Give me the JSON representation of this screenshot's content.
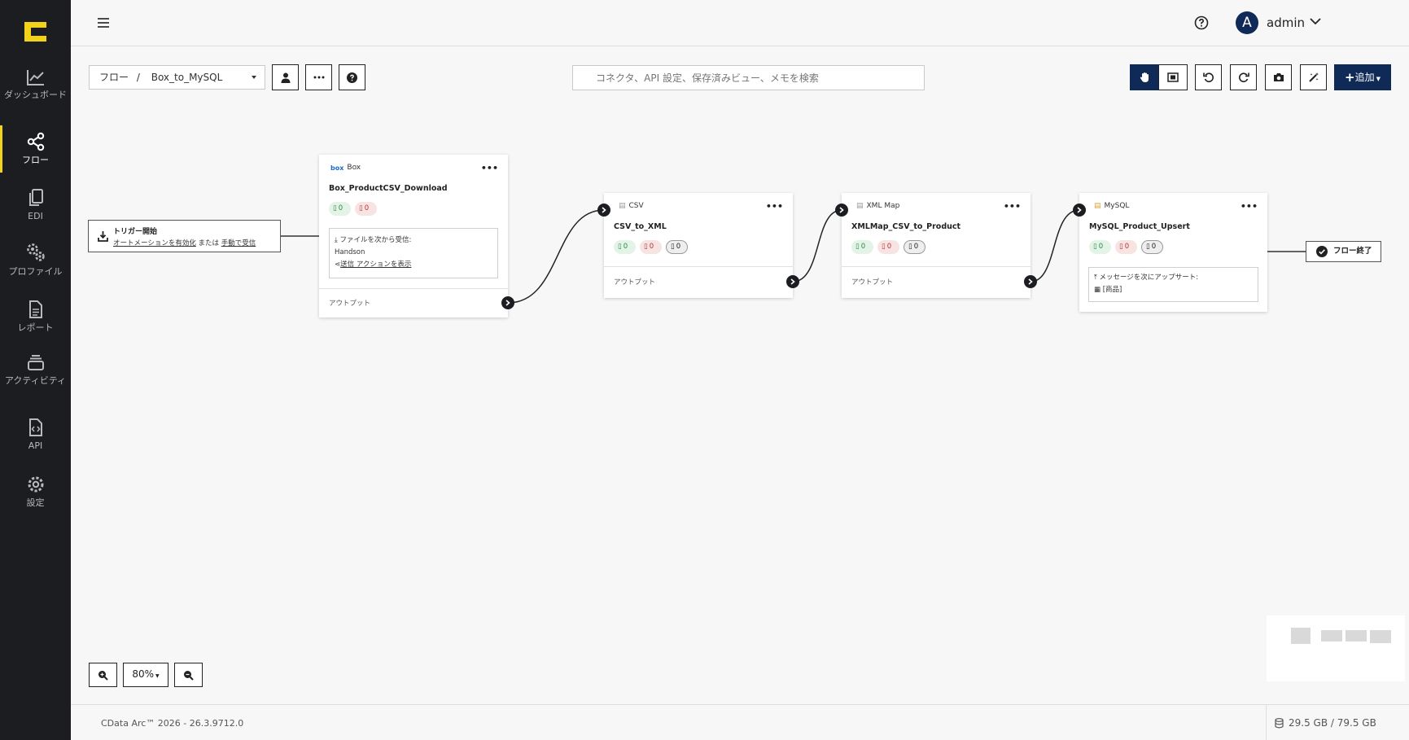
{
  "sidebar": {
    "items": [
      {
        "label": "ダッシュボード"
      },
      {
        "label": "フロー"
      },
      {
        "label": "EDI"
      },
      {
        "label": "プロファイル"
      },
      {
        "label": "レポート"
      },
      {
        "label": "アクティビティ"
      },
      {
        "label": "API"
      },
      {
        "label": "設定"
      }
    ],
    "active": "フロー"
  },
  "header": {
    "avatar_initial": "A",
    "user": "admin"
  },
  "toolbar": {
    "breadcrumb_root": "フロー",
    "breadcrumb_sep": "/",
    "flow_name": "Box_to_MySQL",
    "search_placeholder": "コネクタ、API 設定、保存済みビュー、メモを検索",
    "add_label": "追加"
  },
  "canvas": {
    "trigger": {
      "title": "トリガー開始",
      "link_automation": "オートメーションを有効化",
      "or_text": " または ",
      "link_manual": "手動で受信"
    },
    "nodes": [
      {
        "type": "Box",
        "name": "Box_ProductCSV_Download",
        "ok": "0",
        "err": "0",
        "receive_label": "ファイルを次から受信:",
        "receive_value": "Handson",
        "send_action": "送信 アクションを表示",
        "output": "アウトプット"
      },
      {
        "type": "CSV",
        "name": "CSV_to_XML",
        "ok": "0",
        "err": "0",
        "info": "0",
        "output": "アウトプット"
      },
      {
        "type": "XML Map",
        "name": "XMLMap_CSV_to_Product",
        "ok": "0",
        "err": "0",
        "info": "0",
        "output": "アウトプット"
      },
      {
        "type": "MySQL",
        "name": "MySQL_Product_Upsert",
        "ok": "0",
        "err": "0",
        "info": "0",
        "upsert_label": "メッセージを次にアップサート:",
        "upsert_value": "[商品]"
      }
    ],
    "end": {
      "label": "フロー終了"
    }
  },
  "zoom": {
    "level": "80%"
  },
  "footer": {
    "version": "CData Arc™ 2026 - 26.3.9712.0",
    "disk": "29.5 GB / 79.5 GB"
  },
  "colors": {
    "accent": "#0f2a57",
    "sidebar": "#1b1d21",
    "highlight": "#f3d21c"
  }
}
